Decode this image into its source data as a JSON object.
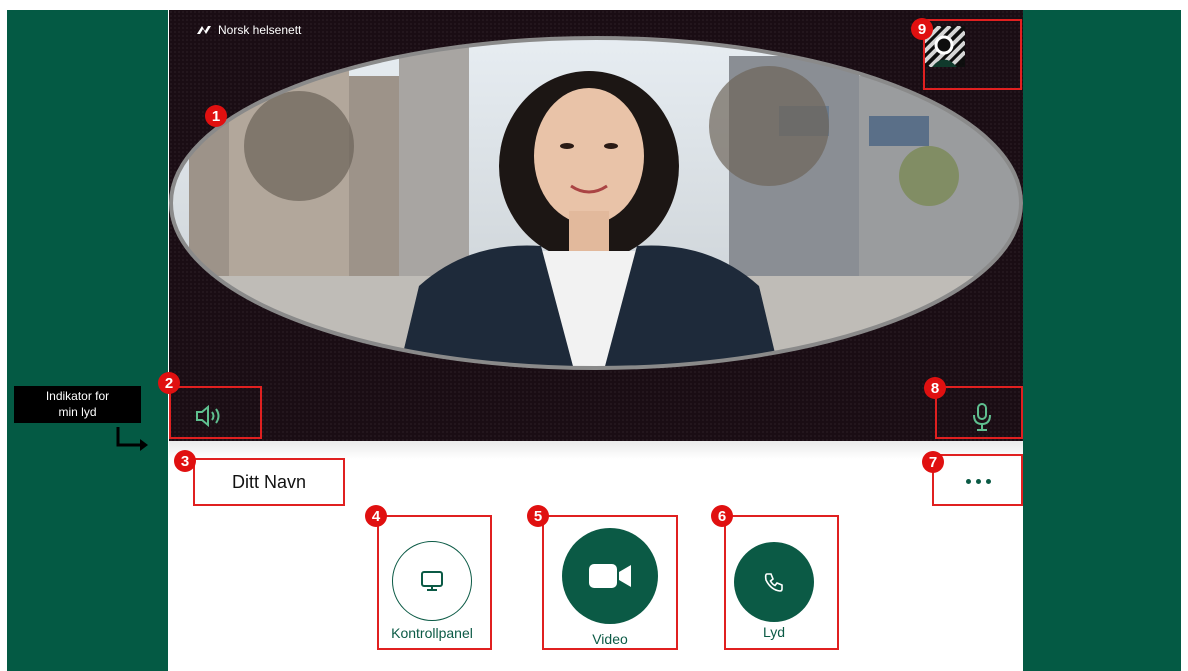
{
  "brand": {
    "name": "Norsk helsenett"
  },
  "markers": [
    "1",
    "2",
    "3",
    "4",
    "5",
    "6",
    "7",
    "8",
    "9"
  ],
  "participant": {
    "name": "Ditt Navn"
  },
  "controls": {
    "kontrollpanel_label": "Kontrollpanel",
    "video_label": "Video",
    "lyd_label": "Lyd"
  },
  "indicator": {
    "text_line1": "Indikator for",
    "text_line2": "min lyd"
  },
  "icons": {
    "speaker": "speaker-icon",
    "mic": "microphone-icon",
    "more": "more-options-icon",
    "monitor": "monitor-icon",
    "video": "video-camera-icon",
    "phone": "phone-icon",
    "avatar": "self-view-avatar-icon"
  },
  "colors": {
    "brand_green": "#045a44",
    "accent_green": "#0b5a45",
    "callout_red": "#e02020",
    "video_bg": "#1a0d14"
  }
}
